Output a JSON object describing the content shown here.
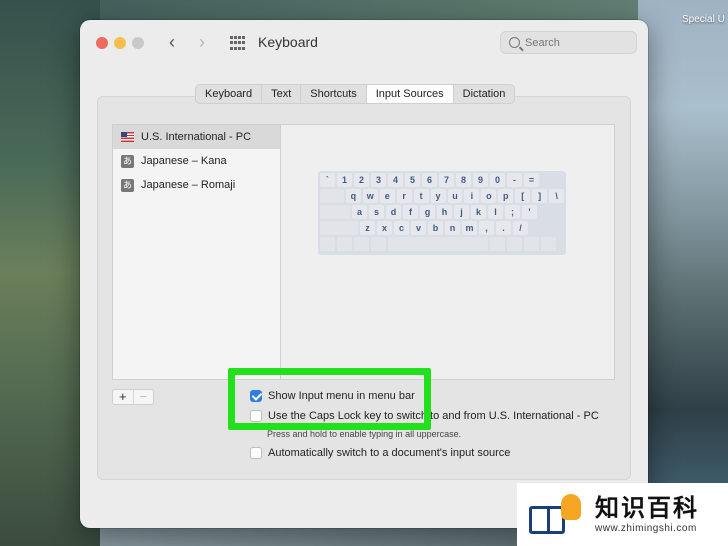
{
  "desktop": {
    "corner_label": "Special U"
  },
  "window": {
    "title": "Keyboard",
    "search_placeholder": "Search",
    "tabs": [
      {
        "label": "Keyboard",
        "active": false
      },
      {
        "label": "Text",
        "active": false
      },
      {
        "label": "Shortcuts",
        "active": false
      },
      {
        "label": "Input Sources",
        "active": true
      },
      {
        "label": "Dictation",
        "active": false
      }
    ],
    "sources": [
      {
        "label": "U.S. International - PC",
        "icon": "us-flag-icon",
        "selected": true
      },
      {
        "label": "Japanese – Kana",
        "icon": "kana-a-icon",
        "selected": false
      },
      {
        "label": "Japanese – Romaji",
        "icon": "kana-a-icon",
        "selected": false
      }
    ],
    "keyboard_rows": [
      [
        "`",
        "1",
        "2",
        "3",
        "4",
        "5",
        "6",
        "7",
        "8",
        "9",
        "0",
        "-",
        "="
      ],
      [
        "q",
        "w",
        "e",
        "r",
        "t",
        "y",
        "u",
        "i",
        "o",
        "p",
        "[",
        "]",
        "\\"
      ],
      [
        "a",
        "s",
        "d",
        "f",
        "g",
        "h",
        "j",
        "k",
        "l",
        ";",
        "'"
      ],
      [
        "z",
        "x",
        "c",
        "v",
        "b",
        "n",
        "m",
        ",",
        ".",
        "/"
      ]
    ],
    "add_label": "+",
    "remove_label": "−",
    "options": {
      "show_input_menu": {
        "label": "Show Input menu in menu bar",
        "checked": true
      },
      "caps_lock": {
        "label": "Use the Caps Lock key to switch to and from U.S. International - PC",
        "checked": false
      },
      "caps_lock_note": "Press and hold to enable typing in all uppercase.",
      "auto_switch": {
        "label": "Automatically switch to a document's input source",
        "checked": false
      }
    }
  },
  "watermark": {
    "title": "知识百科",
    "url": "www.zhimingshi.com"
  },
  "colors": {
    "highlight": "#22e01b",
    "checkbox_accent": "#2f7de1",
    "key_text": "#445a82"
  }
}
